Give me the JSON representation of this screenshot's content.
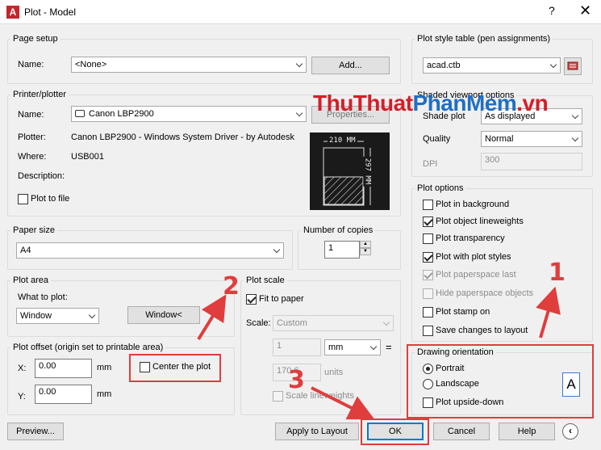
{
  "window": {
    "title": "Plot - Model",
    "help": "?",
    "close": "✕",
    "app_icon": "A"
  },
  "page_setup": {
    "legend": "Page setup",
    "name_label": "Name:",
    "name_value": "<None>",
    "add_button": "Add..."
  },
  "printer": {
    "legend": "Printer/plotter",
    "name_label": "Name:",
    "name_value": "Canon LBP2900",
    "properties_button": "Properties...",
    "plotter_label": "Plotter:",
    "plotter_value": "Canon LBP2900 - Windows System Driver - by Autodesk",
    "where_label": "Where:",
    "where_value": "USB001",
    "description_label": "Description:",
    "plot_to_file": "Plot to file",
    "preview_width": "210 MM",
    "preview_height": "297 MM"
  },
  "paper_size": {
    "legend": "Paper size",
    "value": "A4"
  },
  "copies": {
    "legend": "Number of copies",
    "value": "1"
  },
  "plot_area": {
    "legend": "Plot area",
    "what_label": "What to plot:",
    "value": "Window",
    "window_button": "Window<"
  },
  "plot_offset": {
    "legend": "Plot offset (origin set to printable area)",
    "x_label": "X:",
    "x_value": "0.00",
    "y_label": "Y:",
    "y_value": "0.00",
    "unit": "mm",
    "center": "Center the plot"
  },
  "plot_scale": {
    "legend": "Plot scale",
    "fit": "Fit to paper",
    "scale_label": "Scale:",
    "scale_value": "Custom",
    "num_value": "1",
    "unit_value": "mm",
    "equals": "=",
    "units_value": "170.6",
    "units_label": "units",
    "lineweights": "Scale lineweights"
  },
  "plot_style": {
    "legend": "Plot style table (pen assignments)",
    "value": "acad.ctb"
  },
  "shaded": {
    "legend": "Shaded viewport options",
    "shade_label": "Shade plot",
    "shade_value": "As displayed",
    "quality_label": "Quality",
    "quality_value": "Normal",
    "dpi_label": "DPI",
    "dpi_value": "300"
  },
  "plot_options": {
    "legend": "Plot options",
    "items": [
      {
        "label": "Plot in background",
        "checked": false,
        "disabled": false
      },
      {
        "label": "Plot object lineweights",
        "checked": true,
        "disabled": false
      },
      {
        "label": "Plot transparency",
        "checked": false,
        "disabled": false
      },
      {
        "label": "Plot with plot styles",
        "checked": true,
        "disabled": false
      },
      {
        "label": "Plot paperspace last",
        "checked": true,
        "disabled": true
      },
      {
        "label": "Hide paperspace objects",
        "checked": false,
        "disabled": true
      },
      {
        "label": "Plot stamp on",
        "checked": false,
        "disabled": false
      },
      {
        "label": "Save changes to layout",
        "checked": false,
        "disabled": false
      }
    ]
  },
  "orientation": {
    "legend": "Drawing orientation",
    "portrait": "Portrait",
    "landscape": "Landscape",
    "upside_down": "Plot upside-down",
    "icon_letter": "A"
  },
  "footer": {
    "preview": "Preview...",
    "apply": "Apply to Layout",
    "ok": "OK",
    "cancel": "Cancel",
    "help": "Help"
  },
  "annotations": {
    "n1": "1",
    "n2": "2",
    "n3": "3",
    "watermark_a": "ThuThuat",
    "watermark_b": "PhanMem",
    "watermark_c": ".vn"
  }
}
